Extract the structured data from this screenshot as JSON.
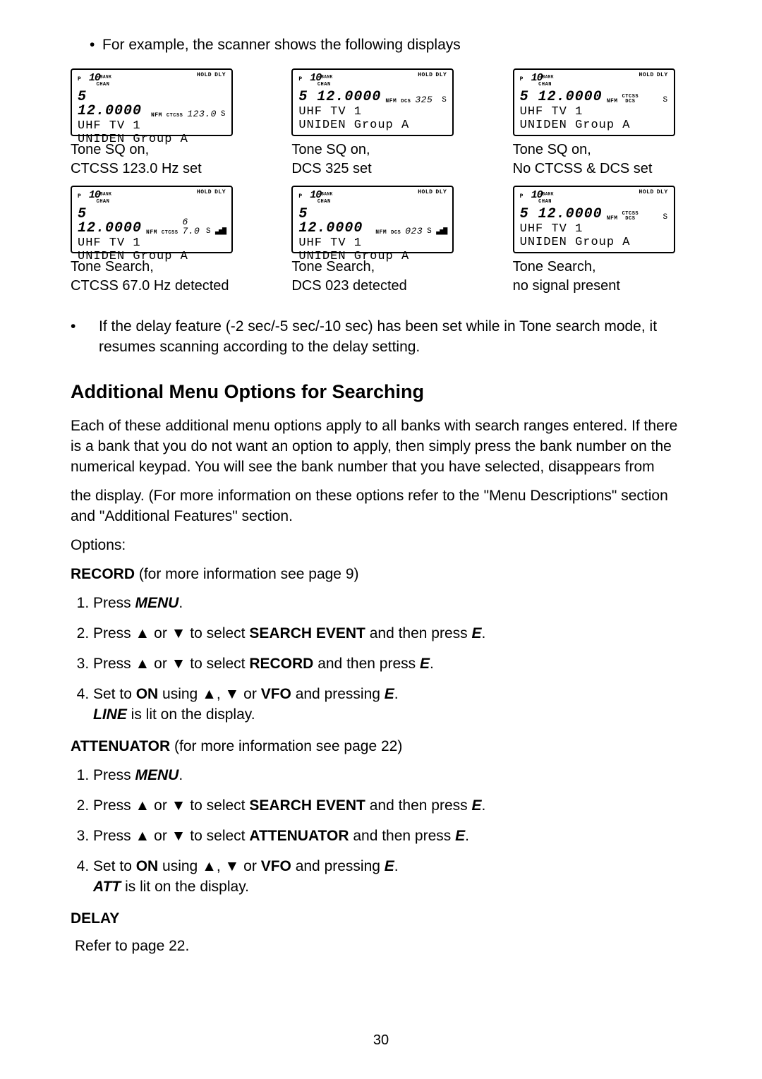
{
  "intro_bullet": "For example, the scanner shows the following displays",
  "displays": [
    {
      "p": "P",
      "ten": "10",
      "bank_flag": "BANK",
      "hold": "HOLD",
      "chan": "CHAN",
      "dly": "DLY",
      "freq": "5 12.0000",
      "nfm": "NFM",
      "tone_flag_top": "CTCSS",
      "tone_flag_bot": "",
      "tone_val": "123.0",
      "s": "S",
      "bars": "",
      "line3": "UHF TV 1",
      "line4": "UNIDEN Group A",
      "cap1": "Tone SQ on,",
      "cap2": "CTCSS 123.0 Hz set"
    },
    {
      "p": "P",
      "ten": "10",
      "bank_flag": "BANK",
      "hold": "HOLD",
      "chan": "CHAN",
      "dly": "DLY",
      "freq": "5 12.0000",
      "nfm": "NFM",
      "tone_flag_top": "",
      "tone_flag_bot": "DCS",
      "tone_val": "325",
      "s": "S",
      "bars": "",
      "line3": "UHF TV 1",
      "line4": "UNIDEN Group A",
      "cap1": "Tone SQ on,",
      "cap2": "DCS 325 set"
    },
    {
      "p": "P",
      "ten": "10",
      "bank_flag": "BANK",
      "hold": "HOLD",
      "chan": "CHAN",
      "dly": "DLY",
      "freq": "5 12.0000",
      "nfm": "NFM",
      "tone_flag_top": "CTCSS",
      "tone_flag_bot": "DCS",
      "tone_val": "",
      "s": "S",
      "bars": "",
      "line3": "UHF TV 1",
      "line4": "UNIDEN Group A",
      "cap1": "Tone SQ on,",
      "cap2": "No CTCSS & DCS set"
    },
    {
      "p": "P",
      "ten": "10",
      "bank_flag": "BANK",
      "hold": "HOLD",
      "chan": "CHAN",
      "dly": "DLY",
      "freq": "5 12.0000",
      "nfm": "NFM",
      "tone_flag_top": "CTCSS",
      "tone_flag_bot": "",
      "tone_val": "6 7.0",
      "s": "S",
      "bars": "▃▅▇",
      "line3": "UHF TV 1",
      "line4": "UNIDEN Group A",
      "cap1": "Tone Search,",
      "cap2": "CTCSS 67.0 Hz detected"
    },
    {
      "p": "P",
      "ten": "10",
      "bank_flag": "BANK",
      "hold": "HOLD",
      "chan": "CHAN",
      "dly": "DLY",
      "freq": "5 12.0000",
      "nfm": "NFM",
      "tone_flag_top": "",
      "tone_flag_bot": "DCS",
      "tone_val": "023",
      "s": "S",
      "bars": "▃▅▇",
      "line3": "UHF TV 1",
      "line4": "UNIDEN Group A",
      "cap1": "Tone Search,",
      "cap2": "DCS 023 detected"
    },
    {
      "p": "P",
      "ten": "10",
      "bank_flag": "BANK",
      "hold": "HOLD",
      "chan": "CHAN",
      "dly": "DLY",
      "freq": "5 12.0000",
      "nfm": "NFM",
      "tone_flag_top": "CTCSS",
      "tone_flag_bot": "DCS",
      "tone_val": "",
      "s": "S",
      "bars": "",
      "line3": "UHF TV 1",
      "line4": "UNIDEN Group A",
      "cap1": "Tone Search,",
      "cap2": "no signal present"
    }
  ],
  "delay_note": "If the delay feature (-2 sec/-5 sec/-10 sec) has been set while in Tone search mode, it resumes scanning according to the delay setting.",
  "section_title": "Additional Menu Options for Searching",
  "section_intro_a": "Each of these additional menu options apply to all banks with search ranges entered. If there is a bank that you do not want an option to apply, then simply press the bank number on the numerical keypad. You will see the bank number that you have selected, disappears from",
  "section_intro_b": "the display. (For more information on these options refer to the \"Menu Descriptions\" section and \"Additional Features\" section.",
  "options_label": "Options:",
  "record": {
    "heading_a": "RECORD",
    "heading_b": " (for more information see page 9)",
    "steps": {
      "s1a": "Press ",
      "s1b": "MENU",
      "s1c": ".",
      "s2a": "Press ",
      "s2up": "▲",
      "s2mid": " or ",
      "s2dn": "▼",
      "s2b": " to select ",
      "s2c": "SEARCH EVENT",
      "s2d": " and then press ",
      "s2e": "E",
      "s2f": ".",
      "s3a": "Press ",
      "s3up": "▲",
      "s3mid": " or ",
      "s3dn": "▼",
      "s3b": " to select ",
      "s3c": "RECORD",
      "s3d": " and then press ",
      "s3e": "E",
      "s3f": ".",
      "s4a": "Set to ",
      "s4b": "ON",
      "s4c": " using ",
      "s4up": "▲",
      "s4comma": ", ",
      "s4dn": "▼",
      "s4d": " or ",
      "s4e": "VFO",
      "s4f": " and pressing ",
      "s4g": "E",
      "s4h": ".",
      "s4i": "LINE",
      "s4j": " is lit on the display."
    }
  },
  "attenuator": {
    "heading_a": "ATTENUATOR",
    "heading_b": " (for more information see page 22)",
    "steps": {
      "s1a": "Press ",
      "s1b": "MENU",
      "s1c": ".",
      "s2a": "Press ",
      "s2up": "▲",
      "s2mid": " or ",
      "s2dn": "▼",
      "s2b": " to select ",
      "s2c": "SEARCH EVENT",
      "s2d": " and then press ",
      "s2e": "E",
      "s2f": ".",
      "s3a": "Press ",
      "s3up": "▲",
      "s3mid": " or ",
      "s3dn": "▼",
      "s3b": " to select ",
      "s3c": "ATTENUATOR",
      "s3d": " and then press ",
      "s3e": "E",
      "s3f": ".",
      "s4a": "Set to ",
      "s4b": "ON",
      "s4c": " using ",
      "s4up": "▲",
      "s4comma": ", ",
      "s4dn": "▼",
      "s4d": " or ",
      "s4e": "VFO",
      "s4f": " and pressing ",
      "s4g": "E",
      "s4h": ".",
      "s4i": "ATT",
      "s4j": " is lit on the display."
    }
  },
  "delay_heading": "DELAY",
  "delay_body": "Refer to page 22.",
  "page_number": "30"
}
